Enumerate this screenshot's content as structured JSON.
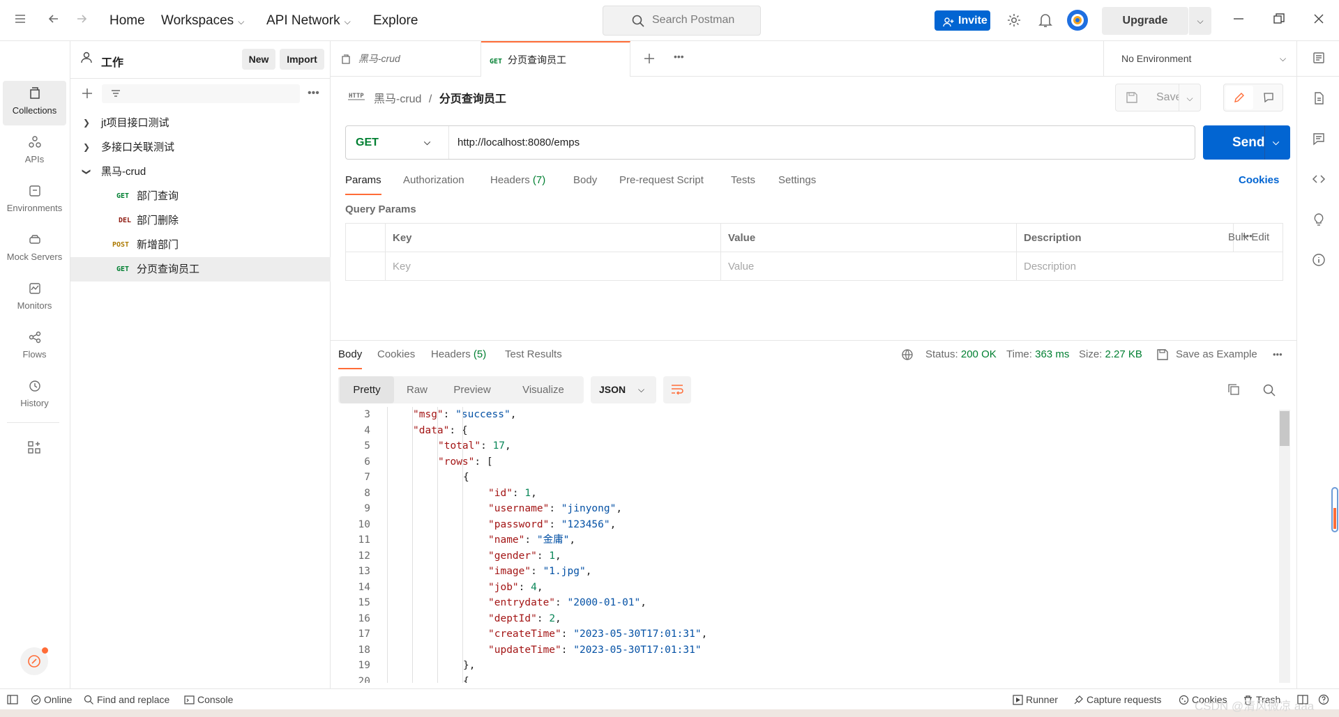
{
  "topbar": {
    "home": "Home",
    "workspaces": "Workspaces",
    "api_network": "API Network",
    "explore": "Explore",
    "search_placeholder": "Search Postman",
    "invite": "Invite",
    "upgrade": "Upgrade"
  },
  "rail": {
    "items": [
      {
        "label": "Collections",
        "icon": "collections-icon"
      },
      {
        "label": "APIs",
        "icon": "apis-icon"
      },
      {
        "label": "Environments",
        "icon": "environments-icon"
      },
      {
        "label": "Mock Servers",
        "icon": "mock-servers-icon"
      },
      {
        "label": "Monitors",
        "icon": "monitors-icon"
      },
      {
        "label": "Flows",
        "icon": "flows-icon"
      },
      {
        "label": "History",
        "icon": "history-icon"
      }
    ]
  },
  "panel": {
    "workspace": "工作",
    "new": "New",
    "import": "Import",
    "collections": [
      {
        "label": "jt项目接口测试"
      },
      {
        "label": "多接口关联测试"
      },
      {
        "label": "黑马-crud"
      }
    ],
    "requests": [
      {
        "method": "GET",
        "label": "部门查询"
      },
      {
        "method": "DEL",
        "label": "部门删除"
      },
      {
        "method": "POST",
        "label": "新增部门"
      },
      {
        "method": "GET",
        "label": "分页查询员工"
      }
    ]
  },
  "tabs": {
    "tab1": "黑马-crud",
    "tab2_method": "GET",
    "tab2": "分页查询员工",
    "environment": "No Environment"
  },
  "request": {
    "collection": "黑马-crud",
    "separator": "/",
    "name": "分页查询员工",
    "save": "Save",
    "method": "GET",
    "url": "http://localhost:8080/emps",
    "send": "Send",
    "tabs": {
      "params": "Params",
      "authorization": "Authorization",
      "headers": "Headers",
      "headers_count": "(7)",
      "body": "Body",
      "prerequest": "Pre-request Script",
      "tests": "Tests",
      "settings": "Settings"
    },
    "cookies": "Cookies",
    "query_params_title": "Query Params",
    "table": {
      "key": "Key",
      "value": "Value",
      "description": "Description",
      "bulk_edit": "Bulk Edit",
      "key_placeholder": "Key",
      "value_placeholder": "Value",
      "description_placeholder": "Description"
    }
  },
  "response": {
    "tabs": {
      "body": "Body",
      "cookies": "Cookies",
      "headers": "Headers",
      "headers_count": "(5)",
      "test_results": "Test Results"
    },
    "status_label": "Status:",
    "status": "200 OK",
    "time_label": "Time:",
    "time": "363 ms",
    "size_label": "Size:",
    "size": "2.27 KB",
    "save_example": "Save as Example",
    "views": [
      "Pretty",
      "Raw",
      "Preview",
      "Visualize"
    ],
    "format": "JSON",
    "lines": [
      {
        "n": "3",
        "indent": 1,
        "parts": [
          [
            "k",
            "\"msg\""
          ],
          [
            "p",
            ": "
          ],
          [
            "sv",
            "\"success\""
          ],
          [
            "p",
            ","
          ]
        ]
      },
      {
        "n": "4",
        "indent": 1,
        "parts": [
          [
            "k",
            "\"data\""
          ],
          [
            "p",
            ": {"
          ]
        ]
      },
      {
        "n": "5",
        "indent": 2,
        "parts": [
          [
            "k",
            "\"total\""
          ],
          [
            "p",
            ": "
          ],
          [
            "nv",
            "17"
          ],
          [
            "p",
            ","
          ]
        ]
      },
      {
        "n": "6",
        "indent": 2,
        "parts": [
          [
            "k",
            "\"rows\""
          ],
          [
            "p",
            ": ["
          ]
        ]
      },
      {
        "n": "7",
        "indent": 3,
        "parts": [
          [
            "p",
            "{"
          ]
        ]
      },
      {
        "n": "8",
        "indent": 4,
        "parts": [
          [
            "k",
            "\"id\""
          ],
          [
            "p",
            ": "
          ],
          [
            "nv",
            "1"
          ],
          [
            "p",
            ","
          ]
        ]
      },
      {
        "n": "9",
        "indent": 4,
        "parts": [
          [
            "k",
            "\"username\""
          ],
          [
            "p",
            ": "
          ],
          [
            "sv",
            "\"jinyong\""
          ],
          [
            "p",
            ","
          ]
        ]
      },
      {
        "n": "10",
        "indent": 4,
        "parts": [
          [
            "k",
            "\"password\""
          ],
          [
            "p",
            ": "
          ],
          [
            "sv",
            "\"123456\""
          ],
          [
            "p",
            ","
          ]
        ]
      },
      {
        "n": "11",
        "indent": 4,
        "parts": [
          [
            "k",
            "\"name\""
          ],
          [
            "p",
            ": "
          ],
          [
            "sv",
            "\"金庸\""
          ],
          [
            "p",
            ","
          ]
        ]
      },
      {
        "n": "12",
        "indent": 4,
        "parts": [
          [
            "k",
            "\"gender\""
          ],
          [
            "p",
            ": "
          ],
          [
            "nv",
            "1"
          ],
          [
            "p",
            ","
          ]
        ]
      },
      {
        "n": "13",
        "indent": 4,
        "parts": [
          [
            "k",
            "\"image\""
          ],
          [
            "p",
            ": "
          ],
          [
            "sv",
            "\"1.jpg\""
          ],
          [
            "p",
            ","
          ]
        ]
      },
      {
        "n": "14",
        "indent": 4,
        "parts": [
          [
            "k",
            "\"job\""
          ],
          [
            "p",
            ": "
          ],
          [
            "nv",
            "4"
          ],
          [
            "p",
            ","
          ]
        ]
      },
      {
        "n": "15",
        "indent": 4,
        "parts": [
          [
            "k",
            "\"entrydate\""
          ],
          [
            "p",
            ": "
          ],
          [
            "sv",
            "\"2000-01-01\""
          ],
          [
            "p",
            ","
          ]
        ]
      },
      {
        "n": "16",
        "indent": 4,
        "parts": [
          [
            "k",
            "\"deptId\""
          ],
          [
            "p",
            ": "
          ],
          [
            "nv",
            "2"
          ],
          [
            "p",
            ","
          ]
        ]
      },
      {
        "n": "17",
        "indent": 4,
        "parts": [
          [
            "k",
            "\"createTime\""
          ],
          [
            "p",
            ": "
          ],
          [
            "sv",
            "\"2023-05-30T17:01:31\""
          ],
          [
            "p",
            ","
          ]
        ]
      },
      {
        "n": "18",
        "indent": 4,
        "parts": [
          [
            "k",
            "\"updateTime\""
          ],
          [
            "p",
            ": "
          ],
          [
            "sv",
            "\"2023-05-30T17:01:31\""
          ]
        ]
      },
      {
        "n": "19",
        "indent": 3,
        "parts": [
          [
            "p",
            "},"
          ]
        ]
      },
      {
        "n": "20",
        "indent": 3,
        "parts": [
          [
            "p",
            "{"
          ]
        ]
      }
    ]
  },
  "footer": {
    "online": "Online",
    "find_replace": "Find and replace",
    "console": "Console",
    "runner": "Runner",
    "capture": "Capture requests",
    "cookies": "Cookies",
    "trash": "Trash",
    "watermark": "CSDN @清风微凉 aaa"
  },
  "colors": {
    "accent": "#ff6c37",
    "primary": "#0265d2",
    "get": "#007f31",
    "del": "#8e1a10",
    "post": "#ad7a03"
  }
}
